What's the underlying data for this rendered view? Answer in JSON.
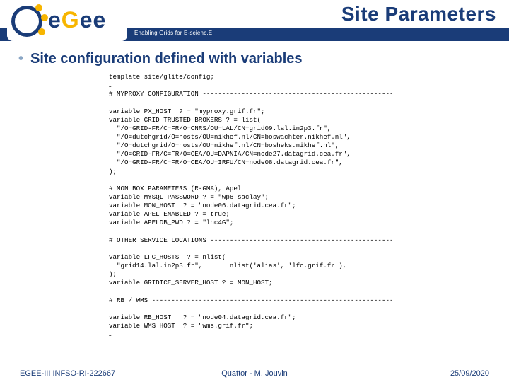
{
  "header": {
    "title": "Site Parameters",
    "tagline": "Enabling Grids for E-scienc.E",
    "logo_text_1": "e",
    "logo_text_2": "G",
    "logo_text_3": "e",
    "logo_text_4": "e"
  },
  "heading": "Site configuration defined with variables",
  "code": "template site/glite/config;\n…\n# MYPROXY CONFIGURATION -------------------------------------------------\n\nvariable PX_HOST  ? = \"myproxy.grif.fr\";\nvariable GRID_TRUSTED_BROKERS ? = list(\n  \"/O=GRID-FR/C=FR/O=CNRS/OU=LAL/CN=grid09.lal.in2p3.fr\",\n  \"/O=dutchgrid/O=hosts/OU=nikhef.nl/CN=boswachter.nikhef.nl\",\n  \"/O=dutchgrid/O=hosts/OU=nikhef.nl/CN=bosheks.nikhef.nl\",\n  \"/O=GRID-FR/C=FR/O=CEA/OU=DAPNIA/CN=node27.datagrid.cea.fr\",\n  \"/O=GRID-FR/C=FR/O=CEA/OU=IRFU/CN=node08.datagrid.cea.fr\",\n);\n\n# MON BOX PARAMETERS (R-GMA), Apel\nvariable MYSQL_PASSWORD ? = \"wp6_saclay\";\nvariable MON_HOST  ? = \"node06.datagrid.cea.fr\";\nvariable APEL_ENABLED ? = true;\nvariable APELDB_PWD ? = \"lhc4G\";\n\n# OTHER SERVICE LOCATIONS -----------------------------------------------\n\nvariable LFC_HOSTS  ? = nlist(\n  \"grid14.lal.in2p3.fr\",       nlist('alias', 'lfc.grif.fr'),\n);\nvariable GRIDICE_SERVER_HOST ? = MON_HOST;\n\n# RB / WMS --------------------------------------------------------------\n\nvariable RB_HOST   ? = \"node04.datagrid.cea.fr\";\nvariable WMS_HOST  ? = \"wms.grif.fr\";\n…",
  "footer": {
    "left": "EGEE-III INFSO-RI-222667",
    "center": "Quattor - M. Jouvin",
    "right": "25/09/2020"
  }
}
